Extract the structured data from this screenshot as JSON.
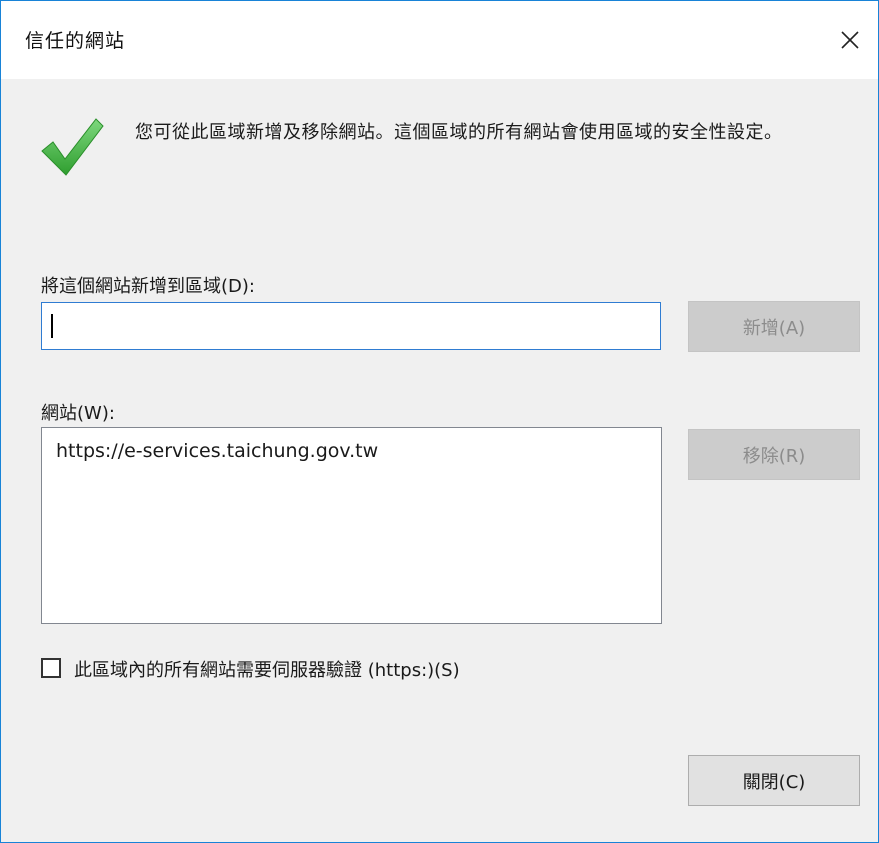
{
  "window": {
    "title": "信任的網站",
    "close_label": "×"
  },
  "header": {
    "description": "您可從此區域新增及移除網站。這個區域的所有網站會使用區域的安全性設定。",
    "icon": "green-checkmark-icon"
  },
  "add_site": {
    "label": "將這個網站新增到區域(D):",
    "input_value": "",
    "add_button_label": "新增(A)",
    "add_button_enabled": false
  },
  "sites": {
    "label": "網站(W):",
    "items": [
      "https://e-services.taichung.gov.tw"
    ],
    "remove_button_label": "移除(R)",
    "remove_button_enabled": false
  },
  "require_https": {
    "label": "此區域內的所有網站需要伺服器驗證 (https:)(S)",
    "checked": false
  },
  "footer": {
    "close_button_label": "關閉(C)"
  },
  "colors": {
    "accent_border": "#1883d7",
    "check_green": "#3cb33c",
    "dialog_bg": "#f0f0f0"
  }
}
